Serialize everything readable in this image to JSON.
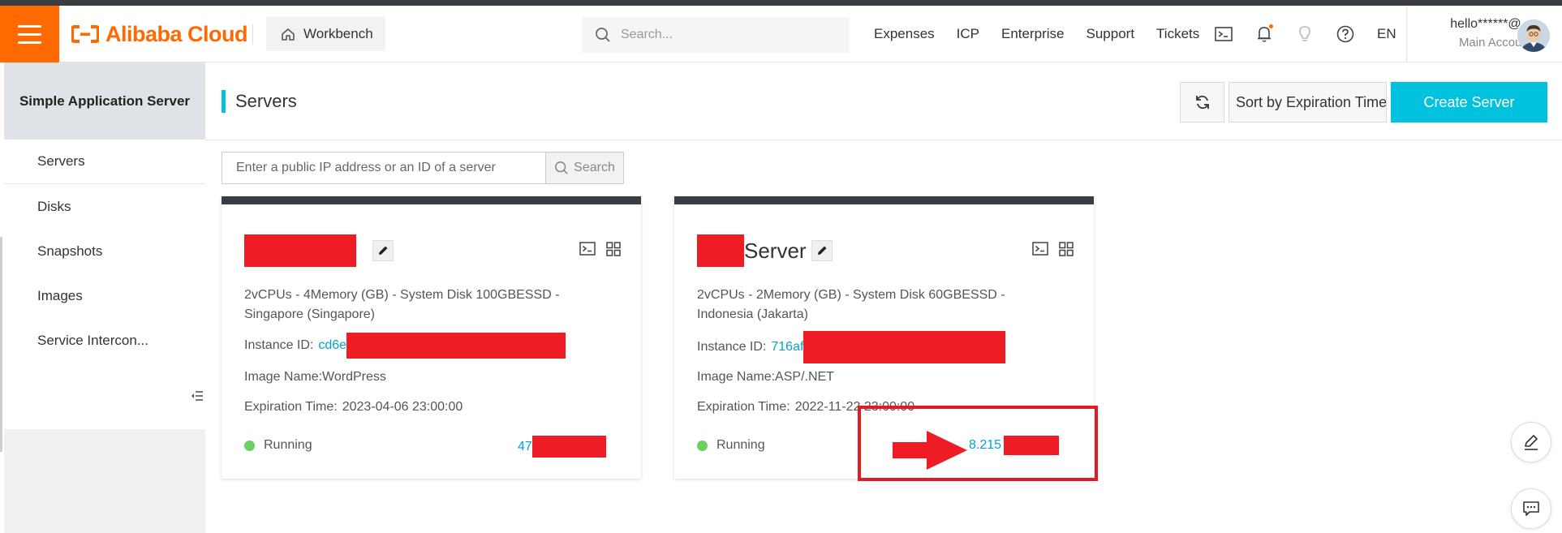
{
  "topbar": {
    "menu_icon": "hamburger-menu-icon",
    "logo_text": "Alibaba Cloud",
    "workbench_label": "Workbench",
    "search_placeholder": "Search...",
    "nav_links": [
      "Expenses",
      "ICP",
      "Enterprise",
      "Support",
      "Tickets"
    ],
    "icons": [
      "terminal-icon",
      "bell-icon",
      "lightbulb-icon",
      "help-icon"
    ],
    "language": "EN",
    "account_user": "hello******@...",
    "account_role": "Main Account",
    "accent_color": "#ff6a00"
  },
  "sidebar": {
    "title": "Simple Application Server",
    "items": [
      {
        "label": "Servers"
      },
      {
        "label": "Disks"
      },
      {
        "label": "Snapshots"
      },
      {
        "label": "Images"
      },
      {
        "label": "Service Intercon..."
      }
    ]
  },
  "header": {
    "title": "Servers",
    "sort_label": "Sort by Expiration Time",
    "create_label": "Create Server",
    "create_color": "#00c1de"
  },
  "filter": {
    "placeholder": "Enter a public IP address or an ID of a server",
    "button_label": "Search"
  },
  "servers": [
    {
      "name": "",
      "spec": "2vCPUs - 4Memory (GB) - System Disk 100GBESSD - Singapore (Singapore)",
      "instance_label": "Instance ID:",
      "instance_id": "cd6e",
      "image_label": "Image Name:",
      "image_name": "WordPress",
      "expiration_label": "Expiration Time:",
      "expiration": "2023-04-06 23:00:00",
      "status": "Running",
      "ip": "47"
    },
    {
      "name": "Server",
      "spec": "2vCPUs - 2Memory (GB) - System Disk 60GBESSD - Indonesia (Jakarta)",
      "instance_label": "Instance ID:",
      "instance_id": "716af",
      "image_label": "Image Name:",
      "image_name": "ASP/.NET",
      "expiration_label": "Expiration Time:",
      "expiration": "2022-11-22 23:00:00",
      "status": "Running",
      "ip": "8.215"
    }
  ],
  "annotation": {
    "highlight_color": "#e01b24",
    "redaction_color": "#ee1c25"
  }
}
